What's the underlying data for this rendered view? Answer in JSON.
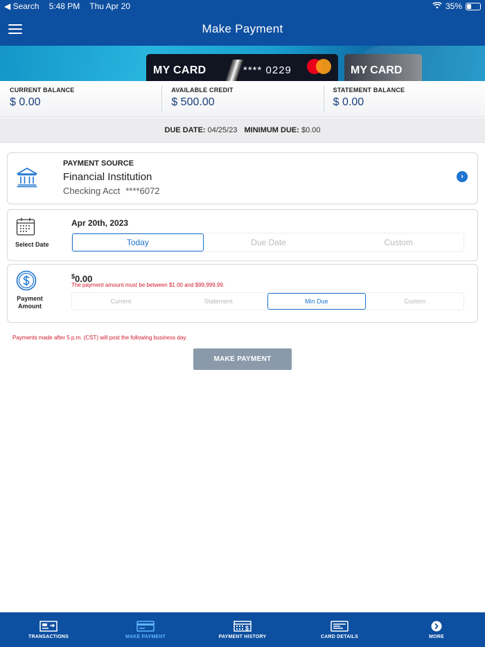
{
  "status_bar": {
    "back_label": "◀ Search",
    "time": "5:48 PM",
    "date": "Thu Apr 20",
    "battery": "35%"
  },
  "nav": {
    "title": "Make Payment"
  },
  "cards": [
    {
      "label": "MY CARD",
      "number": "**** 0229",
      "brand": "mastercard"
    },
    {
      "label": "MY CARD"
    }
  ],
  "balances": [
    {
      "label": "CURRENT BALANCE",
      "value": "$ 0.00"
    },
    {
      "label": "AVAILABLE CREDIT",
      "value": "$ 500.00"
    },
    {
      "label": "STATEMENT BALANCE",
      "value": "$ 0.00"
    }
  ],
  "due": {
    "due_date_label": "DUE DATE:",
    "due_date_value": "04/25/23",
    "min_due_label": "MINIMUM DUE:",
    "min_due_value": "$0.00"
  },
  "payment_source": {
    "title": "PAYMENT SOURCE",
    "institution": "Financial Institution",
    "account_type": "Checking Acct",
    "account_mask": "****6072",
    "icon": "bank-icon"
  },
  "select_date": {
    "side_label": "Select Date",
    "selected_date": "Apr 20th, 2023",
    "options": [
      "Today",
      "Due Date",
      "Custom"
    ],
    "active_index": 0,
    "icon": "calendar-icon"
  },
  "payment_amount": {
    "side_label_1": "Payment",
    "side_label_2": "Amount",
    "currency_symbol": "$",
    "amount": "0.00",
    "error": "The payment amount must be between $1.00 and $99,999.99.",
    "options": [
      "Current",
      "Statement",
      "Min Due",
      "Custom"
    ],
    "active_index": 2,
    "icon": "dollar-circle-icon"
  },
  "cutoff_notice": "Payments made after 5 p.m. (CST) will post the following business day.",
  "make_payment_button": "MAKE PAYMENT",
  "tabs": [
    {
      "label": "TRANSACTIONS",
      "icon": "transactions-icon"
    },
    {
      "label": "MAKE PAYMENT",
      "icon": "card-payment-icon"
    },
    {
      "label": "PAYMENT HISTORY",
      "icon": "payment-history-icon"
    },
    {
      "label": "CARD DETAILS",
      "icon": "card-details-icon"
    },
    {
      "label": "MORE",
      "icon": "chevron-right-circle-icon"
    }
  ],
  "active_tab_index": 1,
  "colors": {
    "brand_blue": "#0d4fa0",
    "accent_blue": "#1c73d1",
    "error_red": "#d0192d",
    "disabled_button": "#8a9aaa",
    "active_tab": "#5fb6ff"
  }
}
